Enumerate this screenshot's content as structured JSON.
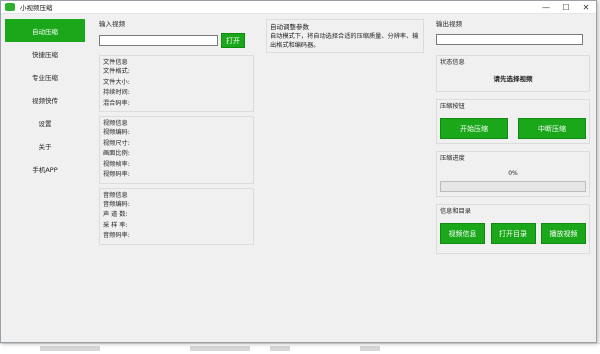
{
  "window": {
    "title": "小视频压缩"
  },
  "controls": {
    "minimize": "—",
    "maximize": "☐",
    "close": "✕"
  },
  "sidebar": {
    "items": [
      {
        "label": "自动压缩",
        "active": true
      },
      {
        "label": "快捷压缩",
        "active": false
      },
      {
        "label": "专业压缩",
        "active": false
      },
      {
        "label": "视频快传",
        "active": false
      },
      {
        "label": "设置",
        "active": false
      },
      {
        "label": "关于",
        "active": false
      },
      {
        "label": "手机APP",
        "active": false
      }
    ]
  },
  "input": {
    "label": "输入视频",
    "value": "",
    "open_button": "打开"
  },
  "file_info": {
    "title": "文件信息",
    "fields": [
      "文件格式:",
      "文件大小:",
      "持续时间:",
      "混合码率:"
    ]
  },
  "video_info": {
    "title": "视频信息",
    "fields": [
      "视频编码:",
      "视频尺寸:",
      "画面比例:",
      "视频帧率:",
      "视频码率:"
    ]
  },
  "audio_info": {
    "title": "音频信息",
    "fields": [
      "音频编码:",
      "声 道 数:",
      "采 样 率:",
      "音频码率:"
    ]
  },
  "auto": {
    "title": "自动调整参数",
    "description": "自动模式下，将自动选择合适的压缩质量、分辨率、输出格式和编码器。"
  },
  "output": {
    "label": "输出视频",
    "value": ""
  },
  "status": {
    "title": "状态信息",
    "text": "请先选择视频"
  },
  "compress_buttons": {
    "title": "压缩按钮",
    "start": "开始压缩",
    "stop": "中断压缩"
  },
  "progress": {
    "title": "压缩进度",
    "text": "0%",
    "value": 0
  },
  "info_dir": {
    "title": "信息和目录",
    "video_info": "视频信息",
    "open_dir": "打开目录",
    "play_video": "播放视频"
  },
  "colors": {
    "accent": "#1aa81a",
    "window_bg": "#f0f0f0"
  }
}
